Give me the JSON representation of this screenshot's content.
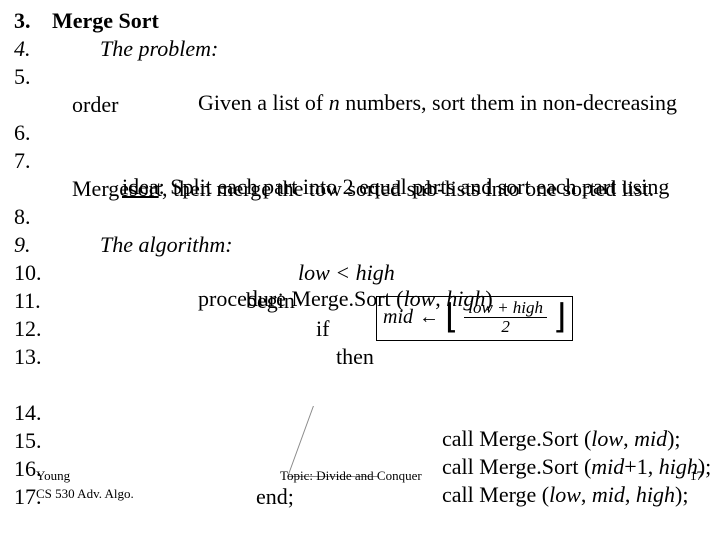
{
  "lines": {
    "n3": "3.",
    "t3": "Merge Sort",
    "n4": "4.",
    "t4": "The problem:",
    "n5": "5.",
    "t5a": "Given a list of ",
    "t5n": "n",
    "t5b": " numbers, sort them in non-decreasing",
    "t5c": "order",
    "n6": "6.",
    "n7": "7.",
    "t7u": "idea",
    "t7a": ": Split each part into 2 equal parts and sort each part using",
    "t7b": "Mergesort, then merge the tow sorted sub-lists into one sorted list.",
    "n8": "8.",
    "n9": "9.",
    "t9": "The algorithm:",
    "n10": "10.",
    "t10a": "procedure ",
    "t10b": "Merge.Sort (",
    "t10g": "low < high",
    "t10c": "low",
    "t10d": ", ",
    "t10e": "high",
    "t10f": ")",
    "n11": "11.",
    "t11": "begin",
    "n12": "12.",
    "t12": "if",
    "n13": "13.",
    "t13": "then",
    "n14": "14.",
    "t14a": "call Merge.Sort (",
    "t14b": "low",
    "t14c": ", ",
    "t14d": "mid",
    "t14e": ");",
    "n15": "15.",
    "t15a": "call Merge.Sort (",
    "t15b": "mid",
    "t15c": "+1, ",
    "t15d": "high",
    "t15e": ");",
    "n16": "16.",
    "t16a": "call Merge (",
    "t16b": "low",
    "t16c": ", ",
    "t16d": "mid",
    "t16e": ", ",
    "t16f": "high",
    "t16g": ");",
    "n17": "17.",
    "t17": "end;"
  },
  "formula": {
    "lhs": "mid",
    "arrow": "←",
    "numer": "low + high",
    "denom": "2"
  },
  "footer": {
    "young": "Young",
    "course": "CS 530 Adv. Algo.",
    "topic": "Topic: Divide and Conquer",
    "page": "17"
  }
}
